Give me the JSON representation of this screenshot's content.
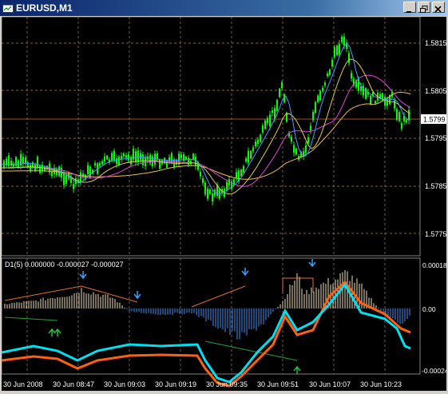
{
  "window": {
    "title": "EURUSD,M1"
  },
  "price_axis": {
    "labels": [
      "1.5815",
      "1.5805",
      "1.5795",
      "1.5785",
      "1.5775"
    ],
    "current_price": "1.5799"
  },
  "indicator": {
    "header": "D1(5) 0.000000 -0.000027 -0.000027",
    "axis_labels": [
      "0.00018",
      "0.00",
      "-0.00024"
    ]
  },
  "time_axis": {
    "labels": [
      "30 Jun 2008",
      "30 Jun 08:47",
      "30 Jun 09:03",
      "30 Jun 09:19",
      "30 Jun 09:35",
      "30 Jun 09:51",
      "30 Jun 10:07",
      "30 Jun 10:23"
    ]
  },
  "colors": {
    "background": "#000000",
    "grid": "#c0a060",
    "candles": "#00ff00",
    "ma_fast": "#3aa0ff",
    "ma_mid": "#e0d040",
    "ma_slow": "#e040e0",
    "ma_long": "#f0c040",
    "cyan_line": "#00e0f0",
    "orange_line": "#ff6010",
    "hist_pos": "#f0e0b0",
    "hist_neg": "#4090f0",
    "arrow": "#3aa0ff",
    "arrow_up": "#20c040",
    "price_line": "#a05030"
  }
}
